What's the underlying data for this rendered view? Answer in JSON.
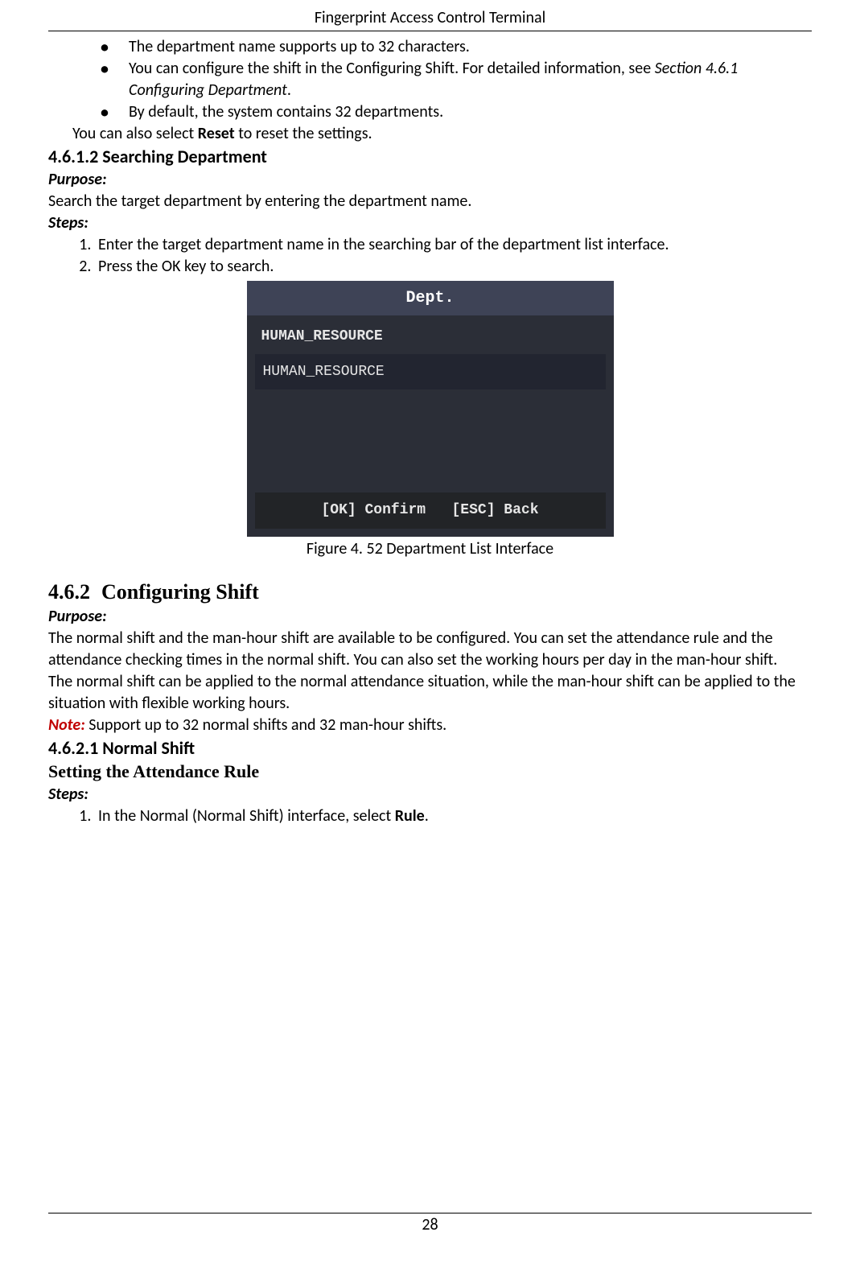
{
  "header": "Fingerprint Access Control Terminal",
  "bullets": [
    "The department name supports up to 32 characters.",
    "",
    "By default, the system contains 32 departments."
  ],
  "bullet2_prefix": "You can configure the shift in the Configuring Shift. For detailed information, see ",
  "bullet2_italic": "Section 4.6.1 Configuring Department",
  "bullet2_suffix": ".",
  "reset_line_prefix": "You can also select ",
  "reset_bold": "Reset",
  "reset_line_suffix": " to reset the settings.",
  "sec_4612": "4.6.1.2 Searching Department",
  "purpose_label": "Purpose:",
  "purpose_4612": "Search the target department by entering the department name.",
  "steps_label": "Steps:",
  "steps_4612": [
    "Enter the target department name in the searching bar of the department list interface.",
    "Press the OK key to search."
  ],
  "device": {
    "title": "Dept.",
    "search_value": "HUMAN_RESOURCE",
    "row1": "HUMAN_RESOURCE",
    "footer_ok": "[OK] Confirm",
    "footer_esc": "[ESC] Back"
  },
  "fig_caption": "Figure 4. 52 Department List Interface",
  "sec_462_num": "4.6.2",
  "sec_462_title": "Configuring Shift",
  "purpose_462_p1": "The normal shift and the man-hour shift are available to be configured. You can set the attendance rule and the attendance checking times in the normal shift. You can also set the working hours per day in the man-hour shift.",
  "purpose_462_p2": "The normal shift can be applied to the normal attendance situation, while the man-hour shift can be applied to the situation with flexible working hours.",
  "note_label": "Note:",
  "note_text": " Support up to 32 normal shifts and 32 man-hour shifts.",
  "sec_4621": "4.6.2.1 Normal Shift",
  "setting_rule": "Setting the Attendance Rule",
  "steps_4621_prefix": "In the Normal (Normal Shift) interface, select ",
  "steps_4621_bold": "Rule",
  "steps_4621_suffix": ".",
  "page_number": "28"
}
